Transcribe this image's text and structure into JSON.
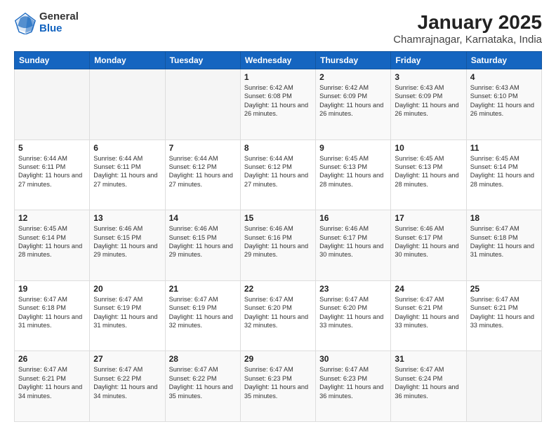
{
  "logo": {
    "general": "General",
    "blue": "Blue"
  },
  "title": "January 2025",
  "subtitle": "Chamrajnagar, Karnataka, India",
  "weekdays": [
    "Sunday",
    "Monday",
    "Tuesday",
    "Wednesday",
    "Thursday",
    "Friday",
    "Saturday"
  ],
  "weeks": [
    [
      {
        "num": "",
        "sunrise": "",
        "sunset": "",
        "daylight": ""
      },
      {
        "num": "",
        "sunrise": "",
        "sunset": "",
        "daylight": ""
      },
      {
        "num": "",
        "sunrise": "",
        "sunset": "",
        "daylight": ""
      },
      {
        "num": "1",
        "sunrise": "Sunrise: 6:42 AM",
        "sunset": "Sunset: 6:08 PM",
        "daylight": "Daylight: 11 hours and 26 minutes."
      },
      {
        "num": "2",
        "sunrise": "Sunrise: 6:42 AM",
        "sunset": "Sunset: 6:09 PM",
        "daylight": "Daylight: 11 hours and 26 minutes."
      },
      {
        "num": "3",
        "sunrise": "Sunrise: 6:43 AM",
        "sunset": "Sunset: 6:09 PM",
        "daylight": "Daylight: 11 hours and 26 minutes."
      },
      {
        "num": "4",
        "sunrise": "Sunrise: 6:43 AM",
        "sunset": "Sunset: 6:10 PM",
        "daylight": "Daylight: 11 hours and 26 minutes."
      }
    ],
    [
      {
        "num": "5",
        "sunrise": "Sunrise: 6:44 AM",
        "sunset": "Sunset: 6:11 PM",
        "daylight": "Daylight: 11 hours and 27 minutes."
      },
      {
        "num": "6",
        "sunrise": "Sunrise: 6:44 AM",
        "sunset": "Sunset: 6:11 PM",
        "daylight": "Daylight: 11 hours and 27 minutes."
      },
      {
        "num": "7",
        "sunrise": "Sunrise: 6:44 AM",
        "sunset": "Sunset: 6:12 PM",
        "daylight": "Daylight: 11 hours and 27 minutes."
      },
      {
        "num": "8",
        "sunrise": "Sunrise: 6:44 AM",
        "sunset": "Sunset: 6:12 PM",
        "daylight": "Daylight: 11 hours and 27 minutes."
      },
      {
        "num": "9",
        "sunrise": "Sunrise: 6:45 AM",
        "sunset": "Sunset: 6:13 PM",
        "daylight": "Daylight: 11 hours and 28 minutes."
      },
      {
        "num": "10",
        "sunrise": "Sunrise: 6:45 AM",
        "sunset": "Sunset: 6:13 PM",
        "daylight": "Daylight: 11 hours and 28 minutes."
      },
      {
        "num": "11",
        "sunrise": "Sunrise: 6:45 AM",
        "sunset": "Sunset: 6:14 PM",
        "daylight": "Daylight: 11 hours and 28 minutes."
      }
    ],
    [
      {
        "num": "12",
        "sunrise": "Sunrise: 6:45 AM",
        "sunset": "Sunset: 6:14 PM",
        "daylight": "Daylight: 11 hours and 28 minutes."
      },
      {
        "num": "13",
        "sunrise": "Sunrise: 6:46 AM",
        "sunset": "Sunset: 6:15 PM",
        "daylight": "Daylight: 11 hours and 29 minutes."
      },
      {
        "num": "14",
        "sunrise": "Sunrise: 6:46 AM",
        "sunset": "Sunset: 6:15 PM",
        "daylight": "Daylight: 11 hours and 29 minutes."
      },
      {
        "num": "15",
        "sunrise": "Sunrise: 6:46 AM",
        "sunset": "Sunset: 6:16 PM",
        "daylight": "Daylight: 11 hours and 29 minutes."
      },
      {
        "num": "16",
        "sunrise": "Sunrise: 6:46 AM",
        "sunset": "Sunset: 6:17 PM",
        "daylight": "Daylight: 11 hours and 30 minutes."
      },
      {
        "num": "17",
        "sunrise": "Sunrise: 6:46 AM",
        "sunset": "Sunset: 6:17 PM",
        "daylight": "Daylight: 11 hours and 30 minutes."
      },
      {
        "num": "18",
        "sunrise": "Sunrise: 6:47 AM",
        "sunset": "Sunset: 6:18 PM",
        "daylight": "Daylight: 11 hours and 31 minutes."
      }
    ],
    [
      {
        "num": "19",
        "sunrise": "Sunrise: 6:47 AM",
        "sunset": "Sunset: 6:18 PM",
        "daylight": "Daylight: 11 hours and 31 minutes."
      },
      {
        "num": "20",
        "sunrise": "Sunrise: 6:47 AM",
        "sunset": "Sunset: 6:19 PM",
        "daylight": "Daylight: 11 hours and 31 minutes."
      },
      {
        "num": "21",
        "sunrise": "Sunrise: 6:47 AM",
        "sunset": "Sunset: 6:19 PM",
        "daylight": "Daylight: 11 hours and 32 minutes."
      },
      {
        "num": "22",
        "sunrise": "Sunrise: 6:47 AM",
        "sunset": "Sunset: 6:20 PM",
        "daylight": "Daylight: 11 hours and 32 minutes."
      },
      {
        "num": "23",
        "sunrise": "Sunrise: 6:47 AM",
        "sunset": "Sunset: 6:20 PM",
        "daylight": "Daylight: 11 hours and 33 minutes."
      },
      {
        "num": "24",
        "sunrise": "Sunrise: 6:47 AM",
        "sunset": "Sunset: 6:21 PM",
        "daylight": "Daylight: 11 hours and 33 minutes."
      },
      {
        "num": "25",
        "sunrise": "Sunrise: 6:47 AM",
        "sunset": "Sunset: 6:21 PM",
        "daylight": "Daylight: 11 hours and 33 minutes."
      }
    ],
    [
      {
        "num": "26",
        "sunrise": "Sunrise: 6:47 AM",
        "sunset": "Sunset: 6:21 PM",
        "daylight": "Daylight: 11 hours and 34 minutes."
      },
      {
        "num": "27",
        "sunrise": "Sunrise: 6:47 AM",
        "sunset": "Sunset: 6:22 PM",
        "daylight": "Daylight: 11 hours and 34 minutes."
      },
      {
        "num": "28",
        "sunrise": "Sunrise: 6:47 AM",
        "sunset": "Sunset: 6:22 PM",
        "daylight": "Daylight: 11 hours and 35 minutes."
      },
      {
        "num": "29",
        "sunrise": "Sunrise: 6:47 AM",
        "sunset": "Sunset: 6:23 PM",
        "daylight": "Daylight: 11 hours and 35 minutes."
      },
      {
        "num": "30",
        "sunrise": "Sunrise: 6:47 AM",
        "sunset": "Sunset: 6:23 PM",
        "daylight": "Daylight: 11 hours and 36 minutes."
      },
      {
        "num": "31",
        "sunrise": "Sunrise: 6:47 AM",
        "sunset": "Sunset: 6:24 PM",
        "daylight": "Daylight: 11 hours and 36 minutes."
      },
      {
        "num": "",
        "sunrise": "",
        "sunset": "",
        "daylight": ""
      }
    ]
  ]
}
